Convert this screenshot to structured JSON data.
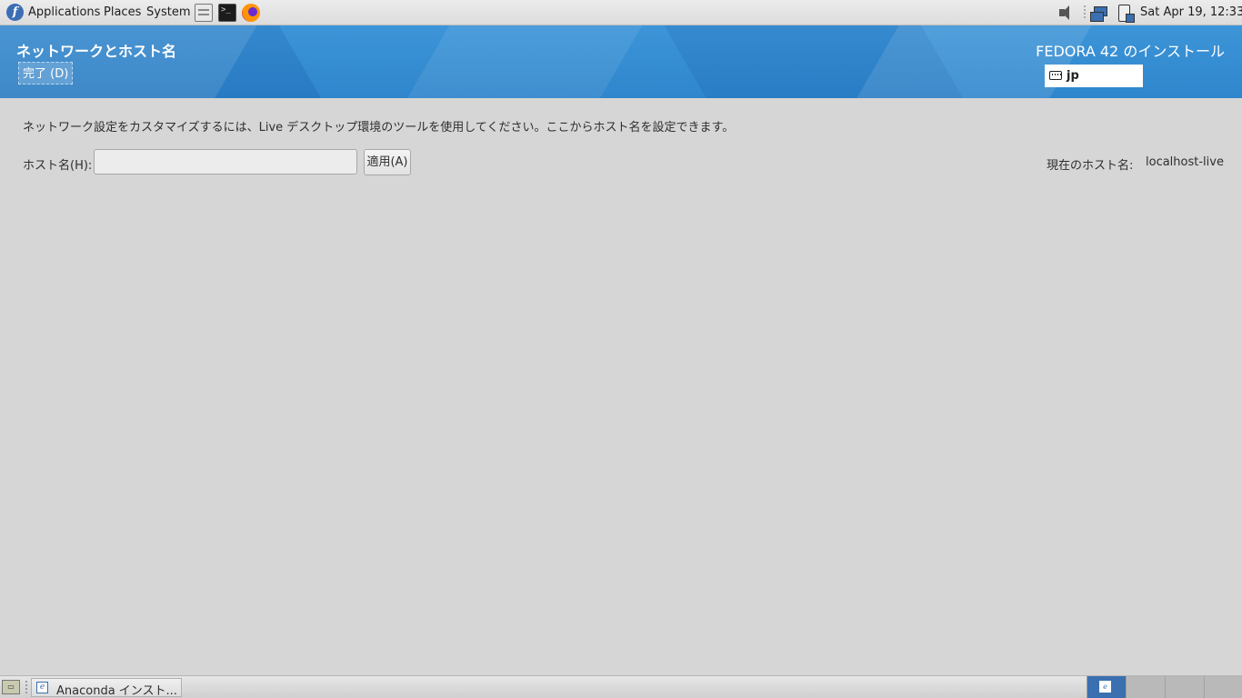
{
  "top_panel": {
    "menus": [
      "Applications",
      "Places",
      "System"
    ],
    "clock": "Sat Apr 19, 12:33"
  },
  "header": {
    "spoke_title": "ネットワークとホスト名",
    "done_label": "完了 (D)",
    "product_title": "FEDORA 42 のインストール",
    "keyboard_layout": "jp"
  },
  "content": {
    "description": "ネットワーク設定をカスタマイズするには、Live デスクトップ環境のツールを使用してください。ここからホスト名を設定できます。",
    "hostname_label": "ホスト名(H):",
    "hostname_value": "",
    "apply_label": "適用(A)",
    "current_hostname_label": "現在のホスト名:",
    "current_hostname_value": "localhost-live"
  },
  "taskbar": {
    "task_label": "Anaconda インスト...",
    "workspaces": 4,
    "active_workspace": 1
  },
  "colors": {
    "header_blue": "#3d95d8",
    "background": "#d6d6d6"
  }
}
